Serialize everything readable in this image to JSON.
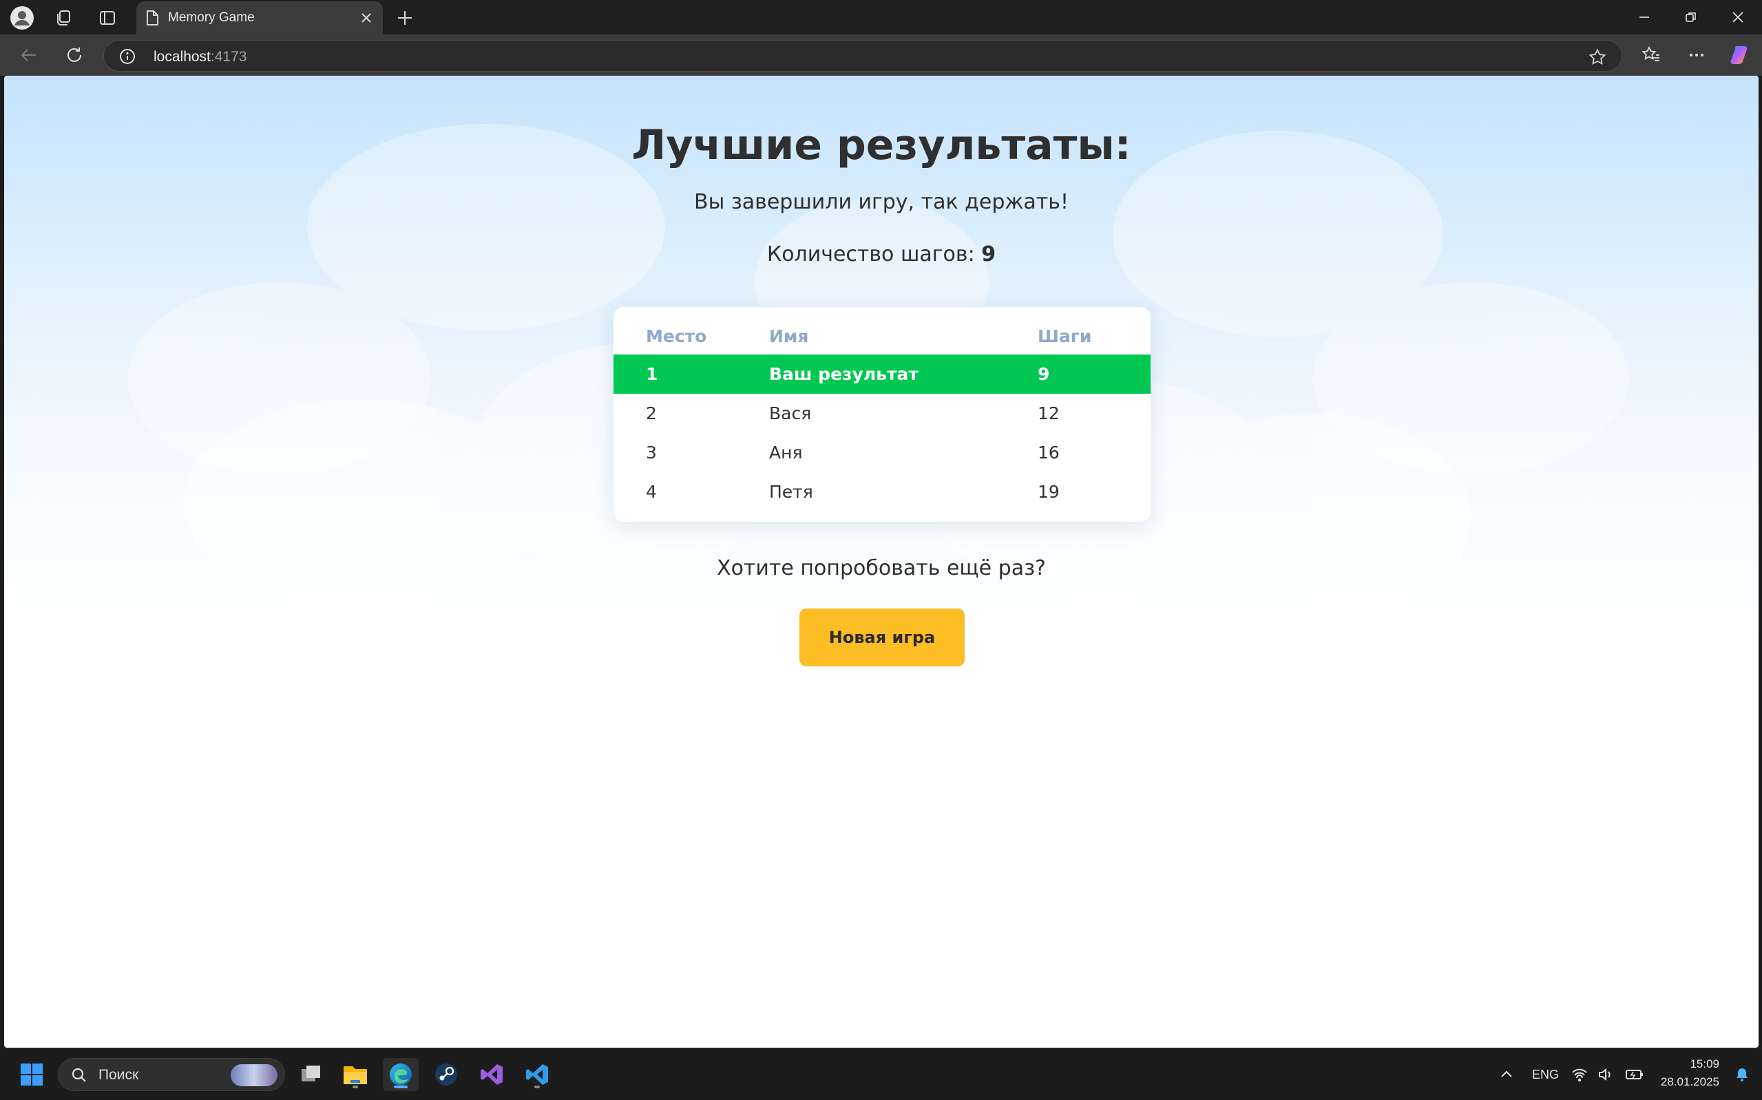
{
  "browser": {
    "tab_title": "Memory Game",
    "url_host": "localhost",
    "url_port": ":4173"
  },
  "page": {
    "title": "Лучшие результаты:",
    "subtitle": "Вы завершили игру, так держать!",
    "steps_label": "Количество шагов:",
    "steps_value": "9",
    "table": {
      "headers": {
        "place": "Место",
        "name": "Имя",
        "steps": "Шаги"
      },
      "rows": [
        {
          "place": "1",
          "name": "Ваш результат",
          "steps": "9",
          "current": true
        },
        {
          "place": "2",
          "name": "Вася",
          "steps": "12"
        },
        {
          "place": "3",
          "name": "Аня",
          "steps": "16"
        },
        {
          "place": "4",
          "name": "Петя",
          "steps": "19"
        }
      ]
    },
    "retry_text": "Хотите попробовать ещё раз?",
    "new_game_label": "Новая игра"
  },
  "colors": {
    "highlight_row": "#00c853",
    "button": "#fcbd25",
    "header_text": "#8fa9c9"
  },
  "taskbar": {
    "search_placeholder": "Поиск",
    "language": "ENG",
    "time": "15:09",
    "date": "28.01.2025",
    "apps": [
      "start-icon",
      "task-view-icon",
      "file-explorer-icon",
      "edge-icon",
      "steam-icon",
      "visual-studio-icon",
      "vscode-icon"
    ]
  }
}
